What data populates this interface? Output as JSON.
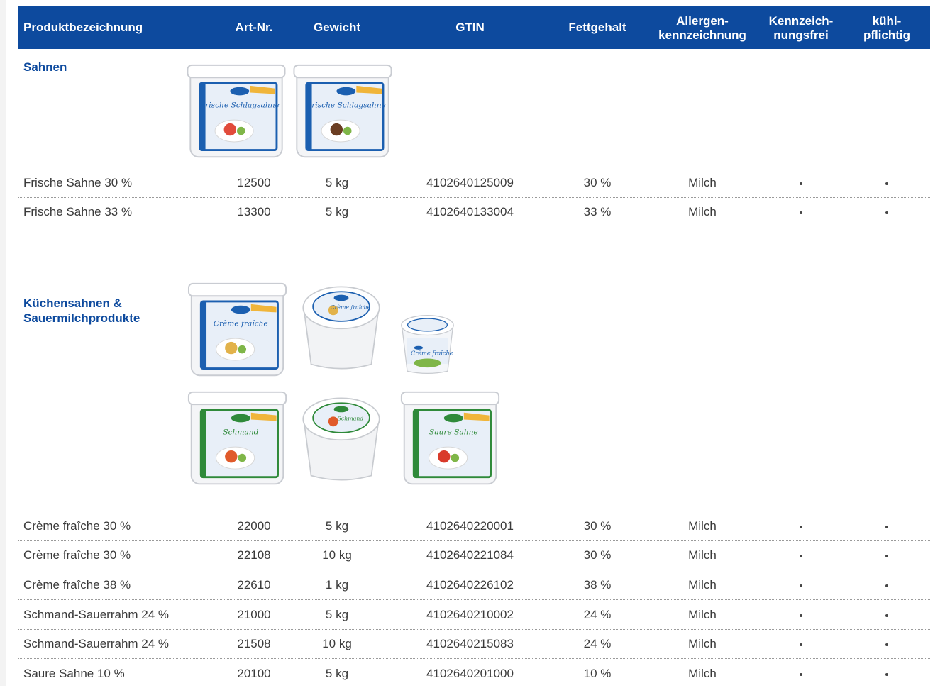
{
  "colors": {
    "header_bg": "#0d4a9e",
    "section_title": "#0d4a9e",
    "text": "#3a3a3a"
  },
  "header": {
    "name": "Produktbezeichnung",
    "art": "Art-Nr.",
    "gewicht": "Gewicht",
    "gtin": "GTIN",
    "fett": "Fettgehalt",
    "allergen": "Allergen-\nkennzeichnung",
    "kennzeichen": "Kennzeich-\nnungsfrei",
    "kuehl": "kühl-\npflichtig"
  },
  "sections": [
    {
      "title": "Sahnen",
      "rows": [
        {
          "name": "Frische Sahne 30 %",
          "art": "12500",
          "gewicht": "5 kg",
          "gtin": "4102640125009",
          "fett": "30 %",
          "allergen": "Milch",
          "kennzeichen": true,
          "kuehl": true
        },
        {
          "name": "Frische Sahne 33 %",
          "art": "13300",
          "gewicht": "5 kg",
          "gtin": "4102640133004",
          "fett": "33 %",
          "allergen": "Milch",
          "kennzeichen": true,
          "kuehl": true
        }
      ]
    },
    {
      "title": "Küchensahnen &\nSauermilchprodukte",
      "rows": [
        {
          "name": "Crème fraîche 30 %",
          "art": "22000",
          "gewicht": "5 kg",
          "gtin": "4102640220001",
          "fett": "30 %",
          "allergen": "Milch",
          "kennzeichen": true,
          "kuehl": true
        },
        {
          "name": "Crème fraîche 30 %",
          "art": "22108",
          "gewicht": "10 kg",
          "gtin": "4102640221084",
          "fett": "30 %",
          "allergen": "Milch",
          "kennzeichen": true,
          "kuehl": true
        },
        {
          "name": "Crème fraîche 38 %",
          "art": "22610",
          "gewicht": "1 kg",
          "gtin": "4102640226102",
          "fett": "38 %",
          "allergen": "Milch",
          "kennzeichen": true,
          "kuehl": true
        },
        {
          "name": "Schmand-Sauerrahm 24 %",
          "art": "21000",
          "gewicht": "5 kg",
          "gtin": "4102640210002",
          "fett": "24 %",
          "allergen": "Milch",
          "kennzeichen": true,
          "kuehl": true
        },
        {
          "name": "Schmand-Sauerrahm 24 %",
          "art": "21508",
          "gewicht": "10 kg",
          "gtin": "4102640215083",
          "fett": "24 %",
          "allergen": "Milch",
          "kennzeichen": true,
          "kuehl": true
        },
        {
          "name": "Saure Sahne 10 %",
          "art": "20100",
          "gewicht": "5 kg",
          "gtin": "4102640201000",
          "fett": "10 %",
          "allergen": "Milch",
          "kennzeichen": true,
          "kuehl": true
        }
      ]
    }
  ],
  "product_images": [
    {
      "type": "bucket-square",
      "label": "Frische Schlagsahne",
      "accent": "#1b5fb0",
      "food": "#e14b3b"
    },
    {
      "type": "bucket-square",
      "label": "Frische Schlagsahne",
      "accent": "#1b5fb0",
      "food": "#6b3e22"
    },
    {
      "type": "bucket-square",
      "label": "Crème fraîche",
      "accent": "#1b5fb0",
      "food": "#e2b24a"
    },
    {
      "type": "pail-round",
      "label": "Crème fraîche",
      "accent": "#1b5fb0",
      "food": "#e2b24a"
    },
    {
      "type": "cup-round",
      "label": "Crème fraîche",
      "accent": "#1b5fb0",
      "food": "#7fb648"
    },
    {
      "type": "bucket-square",
      "label": "Schmand",
      "accent": "#2f8a3a",
      "food": "#e05a2a"
    },
    {
      "type": "pail-round",
      "label": "Schmand",
      "accent": "#2f8a3a",
      "food": "#e05a2a"
    },
    {
      "type": "bucket-square",
      "label": "Saure Sahne",
      "accent": "#2f8a3a",
      "food": "#d93a2a"
    }
  ]
}
